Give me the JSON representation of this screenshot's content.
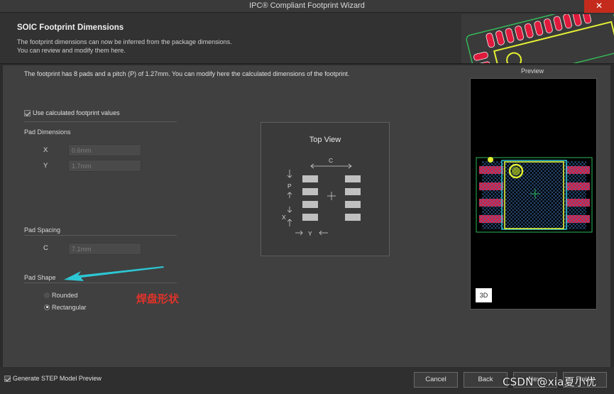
{
  "window": {
    "title": "IPC® Compliant Footprint Wizard",
    "close_glyph": "✕"
  },
  "header": {
    "title": "SOIC Footprint Dimensions",
    "description_line1": "The footprint dimensions can now be inferred from the package dimensions.",
    "description_line2": "You can review and modify them here."
  },
  "summary": "The footprint has 8 pads and a pitch (P) of 1.27mm. You can modify here the calculated dimensions of the footprint.",
  "use_calculated": {
    "label": "Use calculated footprint values",
    "checked": true
  },
  "pad_dimensions": {
    "label": "Pad Dimensions",
    "x": {
      "label": "X",
      "value": "0.6mm"
    },
    "y": {
      "label": "Y",
      "value": "1.7mm"
    }
  },
  "pad_spacing": {
    "label": "Pad Spacing",
    "c": {
      "label": "C",
      "value": "7.1mm"
    }
  },
  "pad_shape": {
    "label": "Pad Shape",
    "options": [
      {
        "label": "Rounded",
        "selected": false
      },
      {
        "label": "Rectangular",
        "selected": true
      }
    ]
  },
  "annotation": {
    "text": "焊盘形状",
    "color": "#e0332a",
    "arrow_color": "#2cc7d4"
  },
  "top_view": {
    "title": "Top View",
    "label_c": "C",
    "label_p": "P",
    "label_x": "X",
    "label_y": "Y"
  },
  "preview": {
    "label": "Preview",
    "button_3d": "3D"
  },
  "footer": {
    "generate_step": {
      "label": "Generate STEP Model Preview",
      "checked": true
    },
    "cancel_label": "Cancel",
    "back_label": "Back",
    "next_label": "Next",
    "finish_label": "Finish"
  },
  "watermark": "CSDN @xia夏小优",
  "colors": {
    "pad_red": "#e01a3c",
    "silk_cyan": "#32d4e0",
    "outline_yellow": "#e4f032",
    "courtyard_green": "#2db85a"
  }
}
